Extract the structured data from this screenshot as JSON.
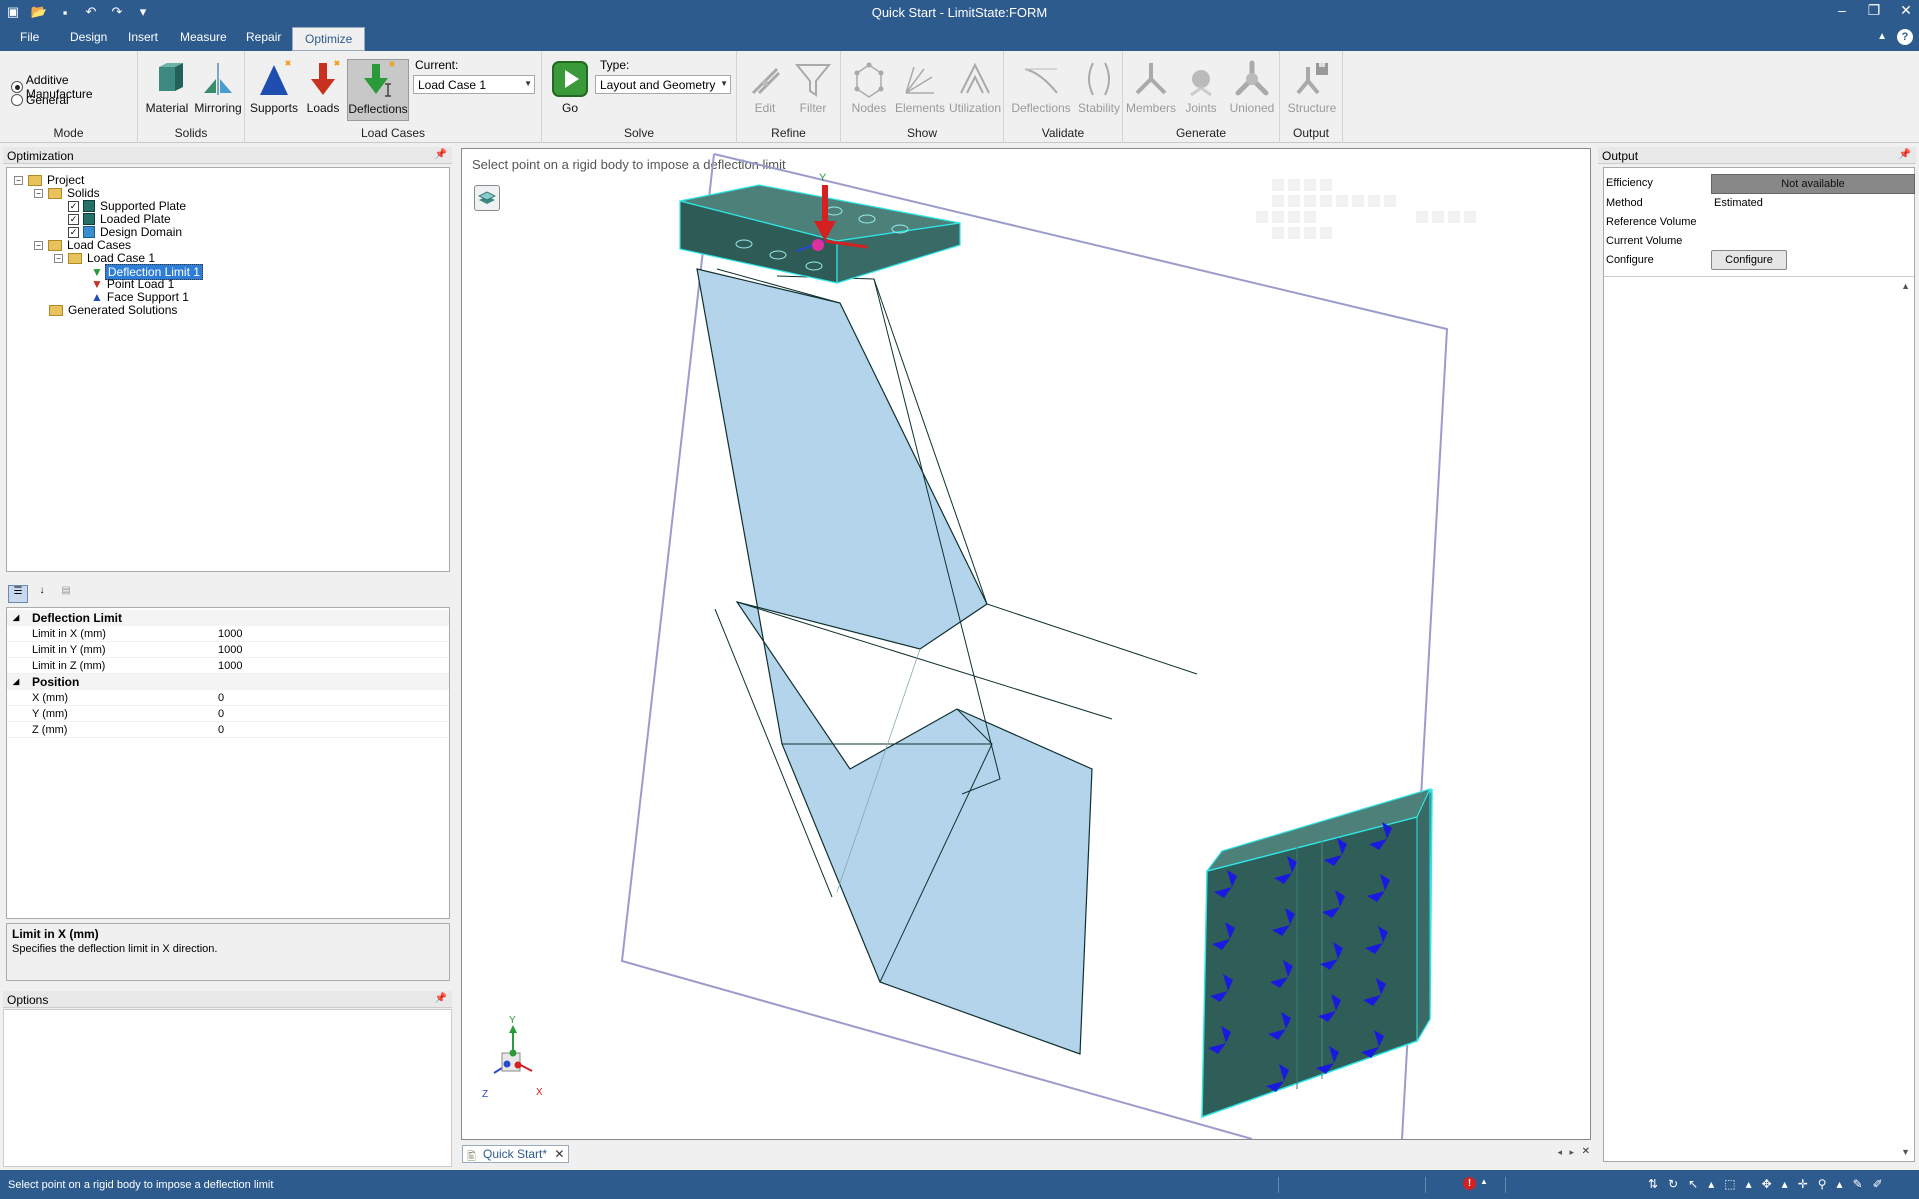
{
  "window": {
    "title": "Quick Start - LimitState:FORM"
  },
  "menu": [
    "File",
    "Design",
    "Insert",
    "Measure",
    "Repair",
    "Optimize"
  ],
  "ribbon": {
    "mode": {
      "options": [
        "Additive Manufacture",
        "General"
      ],
      "selected": "Additive Manufacture",
      "label": "Mode"
    },
    "solids": {
      "buttons": [
        "Material",
        "Mirroring"
      ],
      "label": "Solids"
    },
    "load_cases": {
      "buttons": [
        "Supports",
        "Loads",
        "Deflections"
      ],
      "current_label": "Current:",
      "current_value": "Load Case 1",
      "label": "Load Cases"
    },
    "solve": {
      "go": "Go",
      "type_label": "Type:",
      "type_value": "Layout and Geometry",
      "label": "Solve"
    },
    "refine": {
      "buttons": [
        "Edit",
        "Filter"
      ],
      "label": "Refine"
    },
    "show": {
      "buttons": [
        "Nodes",
        "Elements",
        "Utilization"
      ],
      "label": "Show"
    },
    "validate": {
      "buttons": [
        "Deflections",
        "Stability"
      ],
      "label": "Validate"
    },
    "generate": {
      "buttons": [
        "Members",
        "Joints",
        "Unioned"
      ],
      "label": "Generate"
    },
    "output": {
      "buttons": [
        "Structure"
      ],
      "label": "Output"
    }
  },
  "optimization_panel": {
    "title": "Optimization",
    "tree": {
      "project": "Project",
      "solids": "Solids",
      "supported_plate": "Supported Plate",
      "loaded_plate": "Loaded Plate",
      "design_domain": "Design Domain",
      "load_cases": "Load Cases",
      "load_case_1": "Load Case 1",
      "deflection_limit_1": "Deflection Limit 1",
      "point_load_1": "Point Load 1",
      "face_support_1": "Face Support 1",
      "generated_solutions": "Generated Solutions"
    }
  },
  "properties": {
    "cat1": "Deflection Limit",
    "rows1": [
      {
        "key": "Limit in X (mm)",
        "value": "1000"
      },
      {
        "key": "Limit in Y (mm)",
        "value": "1000"
      },
      {
        "key": "Limit in Z (mm)",
        "value": "1000"
      }
    ],
    "cat2": "Position",
    "rows2": [
      {
        "key": "X (mm)",
        "value": "0"
      },
      {
        "key": "Y (mm)",
        "value": "0"
      },
      {
        "key": "Z (mm)",
        "value": "0"
      }
    ],
    "desc_title": "Limit in X (mm)",
    "desc_text": "Specifies the deflection limit in X direction."
  },
  "options_panel": {
    "title": "Options"
  },
  "viewport": {
    "hint": "Select point on a rigid body to impose a deflection limit",
    "axis_x": "X",
    "axis_y": "Y",
    "axis_z": "Z"
  },
  "doc_tab": "Quick Start*",
  "output_panel": {
    "title": "Output",
    "efficiency_label": "Efficiency",
    "efficiency_value": "Not available",
    "method_label": "Method",
    "method_value": "Estimated",
    "reference_volume_label": "Reference Volume",
    "current_volume_label": "Current Volume",
    "configure_label": "Configure",
    "configure_button": "Configure"
  },
  "status": {
    "text": "Select point on a rigid body to impose a deflection limit"
  },
  "colors": {
    "accent": "#2e5b8e",
    "solid": "#26706a",
    "domain": "#b4d4ec",
    "support": "#1a1adf",
    "load": "#d42020"
  }
}
